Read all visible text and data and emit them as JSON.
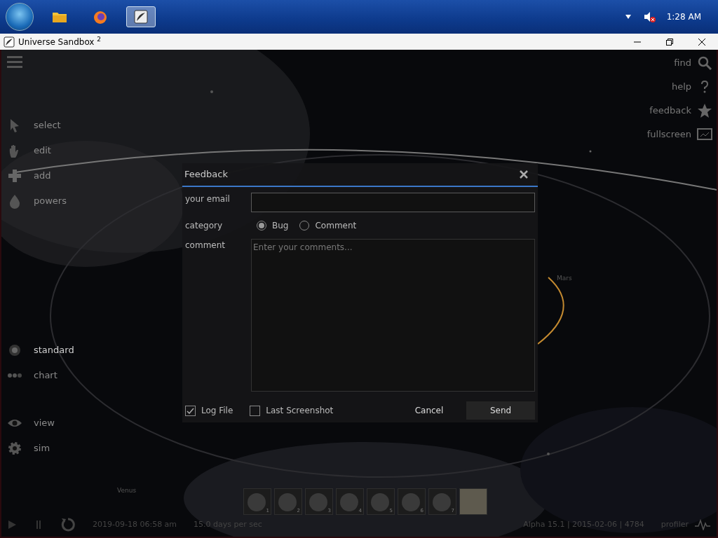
{
  "taskbar": {
    "apps": [
      {
        "kind": "folder",
        "selected": false
      },
      {
        "kind": "browser",
        "selected": false
      },
      {
        "kind": "sandbox",
        "selected": true
      }
    ],
    "muted": true,
    "clock": "1:28 AM"
  },
  "window": {
    "title": "Universe Sandbox $^{2}$"
  },
  "tools": [
    {
      "kind": "pointer",
      "label": "select"
    },
    {
      "kind": "hand",
      "label": "edit"
    },
    {
      "kind": "plus",
      "label": "add"
    },
    {
      "kind": "drop",
      "label": "powers"
    }
  ],
  "modes": [
    {
      "kind": "standard",
      "label": "standard",
      "selected": true
    },
    {
      "kind": "chart",
      "label": "chart",
      "selected": false
    }
  ],
  "panels": [
    {
      "kind": "eye",
      "label": "view"
    },
    {
      "kind": "gear",
      "label": "sim"
    }
  ],
  "right_tools": [
    {
      "kind": "search",
      "label": "find"
    },
    {
      "kind": "help",
      "label": "help"
    },
    {
      "kind": "star",
      "label": "feedback"
    },
    {
      "kind": "screen",
      "label": "fullscreen"
    }
  ],
  "orbit_labels": [
    "Mars",
    "Venus"
  ],
  "thumbnails": [
    {
      "kind": "planet",
      "number": "1"
    },
    {
      "kind": "planet",
      "number": "2"
    },
    {
      "kind": "planet",
      "number": "3"
    },
    {
      "kind": "planet",
      "number": "4"
    },
    {
      "kind": "planet",
      "number": "5"
    },
    {
      "kind": "planet",
      "number": "6"
    },
    {
      "kind": "planet",
      "number": "7"
    },
    {
      "kind": "blank"
    }
  ],
  "bottom_bar": {
    "date": "2019-09-18 06:58 am",
    "speed": "15.0 days per sec",
    "build_info": "Alpha 15.1 | 2015-02-06 | 4784",
    "profiler": "profiler"
  },
  "dialog": {
    "title": "Feedback",
    "email_label": "your email",
    "category_label": "category",
    "categories": [
      {
        "label": "Bug",
        "selected": true
      },
      {
        "label": "Comment",
        "selected": false
      }
    ],
    "comment_label": "comment",
    "comment_placeholder": "Enter your comments...",
    "options": [
      {
        "label": "Log File",
        "checked": true
      },
      {
        "label": "Last Screenshot",
        "checked": false
      }
    ],
    "cancel": "Cancel",
    "send": "Send"
  }
}
